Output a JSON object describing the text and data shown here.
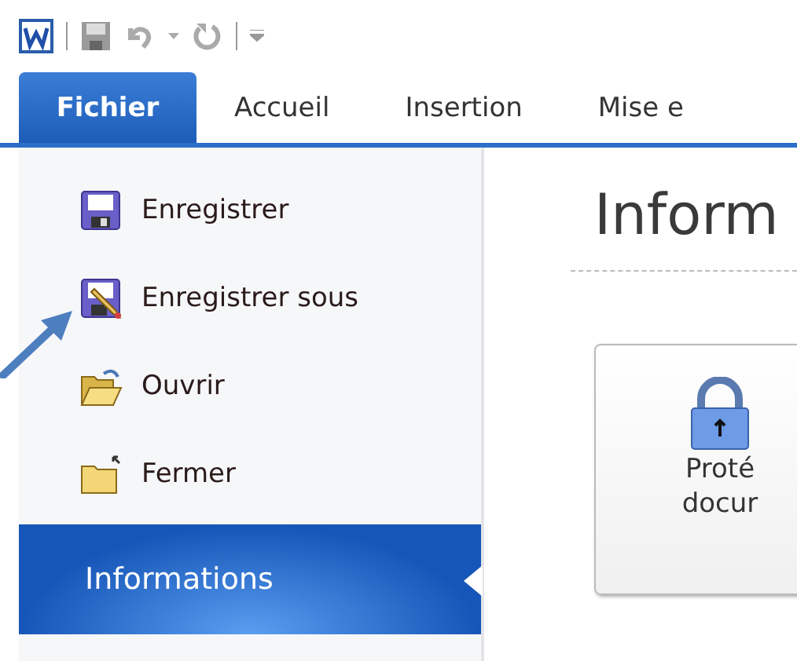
{
  "ribbon_tabs": [
    {
      "label": "Fichier",
      "selected": true
    },
    {
      "label": "Accueil",
      "selected": false
    },
    {
      "label": "Insertion",
      "selected": false
    },
    {
      "label": "Mise e",
      "selected": false
    }
  ],
  "backstage_menu": [
    {
      "label": "Enregistrer",
      "kind": "save",
      "selected": false
    },
    {
      "label": "Enregistrer sous",
      "kind": "save-as",
      "selected": false
    },
    {
      "label": "Ouvrir",
      "kind": "open",
      "selected": false
    },
    {
      "label": "Fermer",
      "kind": "close",
      "selected": false
    },
    {
      "label": "Informations",
      "kind": "section",
      "selected": true
    }
  ],
  "content": {
    "title": "Inform",
    "protect_button": {
      "lines": [
        "Proté",
        "docur"
      ]
    }
  }
}
